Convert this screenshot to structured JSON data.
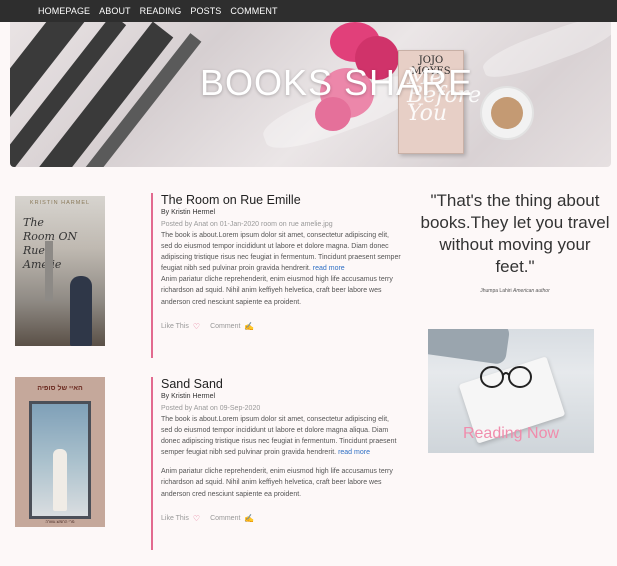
{
  "nav": {
    "links": [
      "HOMEPAGE",
      "ABOUT",
      "READING",
      "POSTS",
      "COMMENT"
    ]
  },
  "hero": {
    "title": "BOOKS SHARE",
    "book_author": "JOJO MOYES",
    "book_title": "Me Before You"
  },
  "posts": [
    {
      "title": "The Room on Rue Emille",
      "author": "By Kristin Hermel",
      "meta": "Posted by Anat on 01-Jan-2020 room on rue amelie.jpg",
      "body": "The book is about.Lorem ipsum dolor sit amet, consectetur adipiscing elit, sed do eiusmod tempor incididunt ut labore et dolore magna. Diam donec adipiscing tristique risus nec feugiat in fermentum. Tincidunt praesent semper feugiat nibh sed pulvinar proin gravida hendrerit.",
      "read_more": "read more",
      "extra": "Anim pariatur cliche reprehenderit, enim eiusmod high life accusamus terry richardson ad squid. Nihil anim keffiyeh helvetica, craft beer labore wes anderson cred nesciunt sapiente ea proident.",
      "like_label": "Like This",
      "comment_label": "Comment",
      "cover_author": "KRISTIN HARMEL",
      "cover_title_lines": [
        "The",
        "Room ON",
        "Rue",
        "Amelie"
      ]
    },
    {
      "title": "Sand Sand",
      "author": "By Kristin Hermel",
      "meta": "Posted by Anat on 09-Sep-2020",
      "body": "The book is about.Lorem ipsum dolor sit amet, consectetur adipiscing elit, sed do eiusmod tempor incididunt ut labore et dolore magna aliqua. Diam donec adipiscing tristique risus nec feugiat in fermentum. Tincidunt praesent semper feugiat nibh sed pulvinar proin gravida hendrerit.",
      "read_more": "read more",
      "extra": "Anim pariatur cliche reprehenderit, enim eiusmod high life accusamus terry richardson ad squid. Nihil anim keffiyeh helvetica, craft beer labore wes anderson cred nesciunt sapiente ea proident.",
      "like_label": "Like This",
      "comment_label": "Comment",
      "cover_title": "האיי של סופיה",
      "cover_bottom": "מרי החמש-עשרה"
    }
  ],
  "quote": {
    "text": "\"That's the thing about books.They let you travel without moving your feet.\"",
    "author": "Jhumpa Lahiri",
    "author_role": "American author"
  },
  "reading_card": {
    "label": "Reading Now"
  },
  "colors": {
    "accent": "#e26a8f",
    "link": "#2e6fc4",
    "navbar": "#2e2e2e",
    "reading_text": "#f08cac"
  }
}
